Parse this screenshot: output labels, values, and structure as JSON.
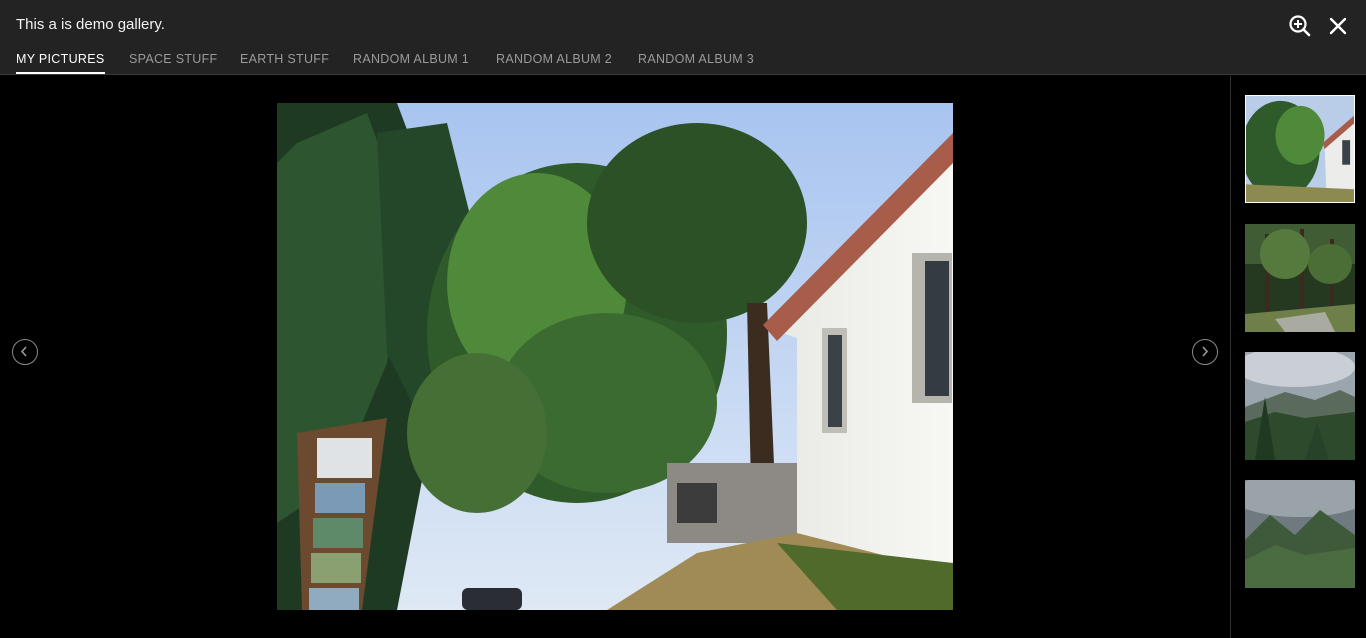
{
  "gallery": {
    "title": "This a is demo gallery."
  },
  "header": {
    "zoom_icon": "zoom-in-icon",
    "close_icon": "close-icon"
  },
  "tabs": [
    {
      "label": "MY PICTURES",
      "active": true
    },
    {
      "label": "SPACE STUFF",
      "active": false
    },
    {
      "label": "EARTH STUFF",
      "active": false
    },
    {
      "label": "RANDOM ALBUM 1",
      "active": false
    },
    {
      "label": "RANDOM ALBUM 2",
      "active": false
    },
    {
      "label": "RANDOM ALBUM 3",
      "active": false
    }
  ],
  "viewer": {
    "prev_icon": "chevron-left-icon",
    "next_icon": "chevron-right-icon",
    "current_image": "trees-and-white-building-photo"
  },
  "thumbnails": [
    {
      "subject": "trees-and-white-building",
      "selected": true
    },
    {
      "subject": "pine-forest",
      "selected": false
    },
    {
      "subject": "mountain-valley-clouds",
      "selected": false
    },
    {
      "subject": "green-mountains-cloudy-sky",
      "selected": false
    }
  ],
  "colors": {
    "header_bg": "#232323",
    "stage_bg": "#000000",
    "active_tab": "#ffffff",
    "inactive_tab": "#9a9a9a"
  }
}
